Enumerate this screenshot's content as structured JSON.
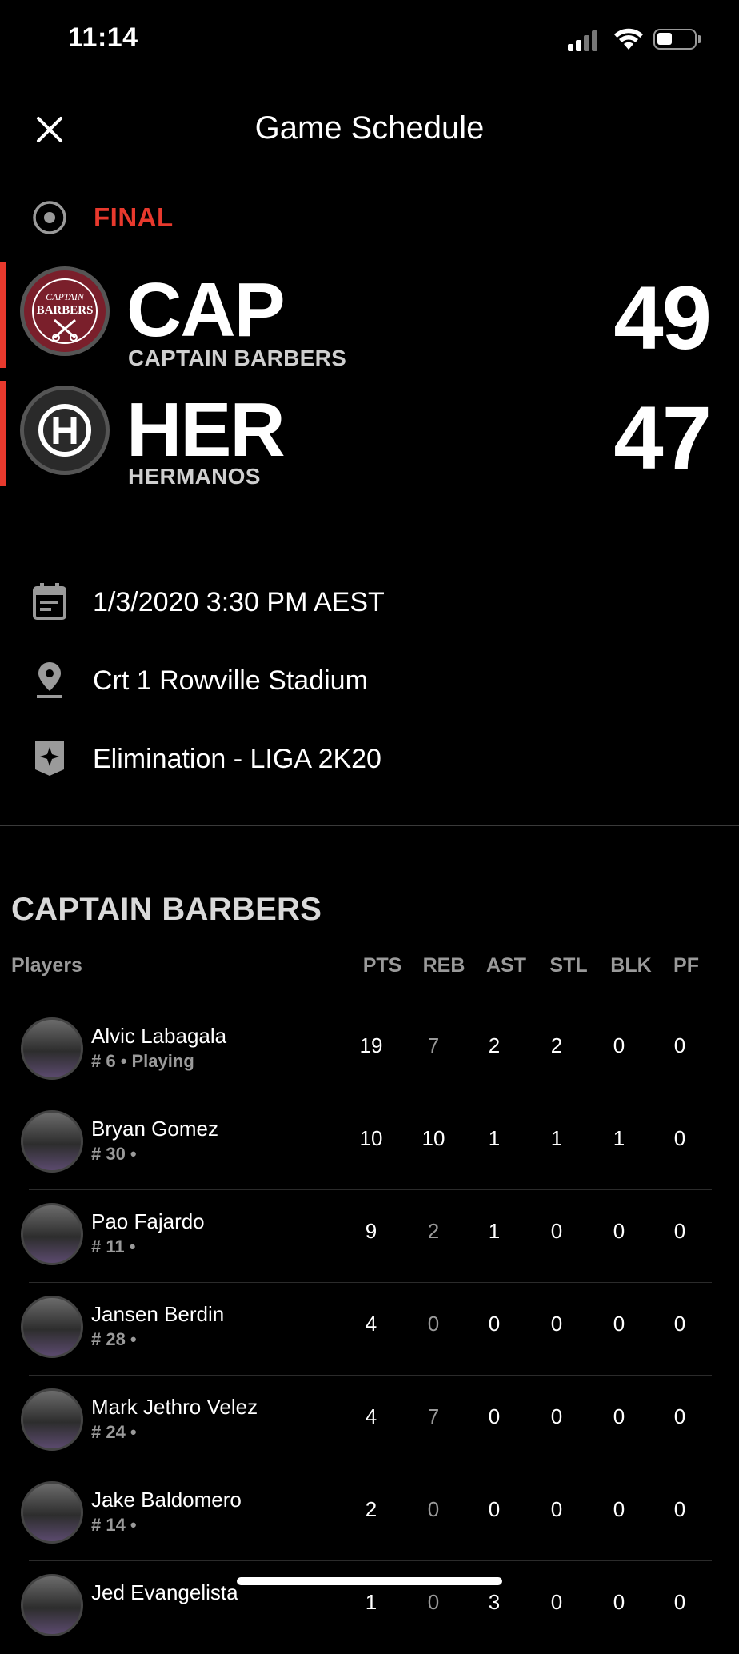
{
  "status_bar": {
    "time": "11:14"
  },
  "header": {
    "title": "Game Schedule"
  },
  "game": {
    "status": "FINAL",
    "teams": [
      {
        "abbr": "CAP",
        "name": "CAPTAIN BARBERS",
        "score": "49",
        "logo_text_1": "CAPTAIN",
        "logo_text_2": "BARBERS"
      },
      {
        "abbr": "HER",
        "name": "HERMANOS",
        "score": "47"
      }
    ]
  },
  "info": {
    "datetime": "1/3/2020 3:30 PM AEST",
    "venue": "Crt 1 Rowville Stadium",
    "competition": "Elimination  - LIGA 2K20"
  },
  "boxscore": {
    "team": "CAPTAIN BARBERS",
    "columns": [
      "Players",
      "PTS",
      "REB",
      "AST",
      "STL",
      "BLK",
      "PF"
    ],
    "players": [
      {
        "name": "Alvic Labagala",
        "meta": "# 6  • Playing",
        "stats": [
          "19",
          "7",
          "2",
          "2",
          "0",
          "0"
        ]
      },
      {
        "name": "Bryan Gomez",
        "meta": "# 30  •",
        "stats": [
          "10",
          "10",
          "1",
          "1",
          "1",
          "0"
        ]
      },
      {
        "name": "Pao Fajardo",
        "meta": "# 11  •",
        "stats": [
          "9",
          "2",
          "1",
          "0",
          "0",
          "0"
        ]
      },
      {
        "name": "Jansen Berdin",
        "meta": "# 28  •",
        "stats": [
          "4",
          "0",
          "0",
          "0",
          "0",
          "0"
        ]
      },
      {
        "name": "Mark Jethro Velez",
        "meta": "# 24  •",
        "stats": [
          "4",
          "7",
          "0",
          "0",
          "0",
          "0"
        ]
      },
      {
        "name": "Jake Baldomero",
        "meta": "# 14  •",
        "stats": [
          "2",
          "0",
          "0",
          "0",
          "0",
          "0"
        ]
      },
      {
        "name": "Jed Evangelista",
        "meta": "",
        "stats": [
          "1",
          "0",
          "3",
          "0",
          "0",
          "0"
        ]
      }
    ]
  },
  "colors": {
    "accent": "#e8392d",
    "background": "#000000",
    "cap_logo": "#7a1f2b",
    "her_logo": "#2a2a2a"
  }
}
